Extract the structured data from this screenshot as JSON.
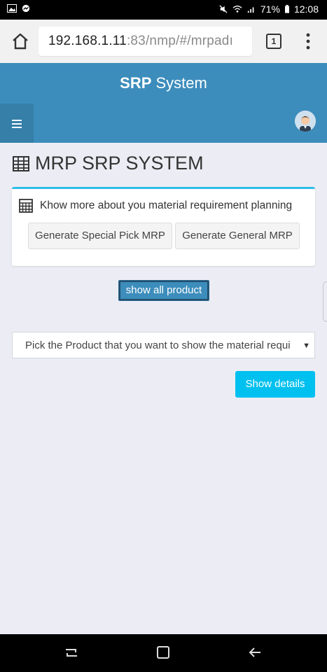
{
  "status_bar": {
    "battery": "71%",
    "time": "12:08",
    "icons": [
      "photo-icon",
      "messenger-icon",
      "mute-icon",
      "wifi-icon",
      "signal-icon",
      "battery-icon"
    ]
  },
  "browser": {
    "url_host": "192.168.1.11",
    "url_rest": ":83/nmp/#/mrpadı",
    "tab_count": "1"
  },
  "app": {
    "title_bold": "SRP",
    "title_rest": " System"
  },
  "page": {
    "title": "MRP SRP SYSTEM"
  },
  "card": {
    "heading": "Khow more about you material requirement planning",
    "btn_special": "Generate Special Pick MRP",
    "btn_general": "Generate General MRP"
  },
  "actions": {
    "show_all": "show all product",
    "select_text": "Pick the Product that you want to show the material requi",
    "show_details": "Show details"
  },
  "colors": {
    "header": "#3c8dbc",
    "accent_info": "#00c0ef",
    "card_border": "#2fbde8"
  }
}
